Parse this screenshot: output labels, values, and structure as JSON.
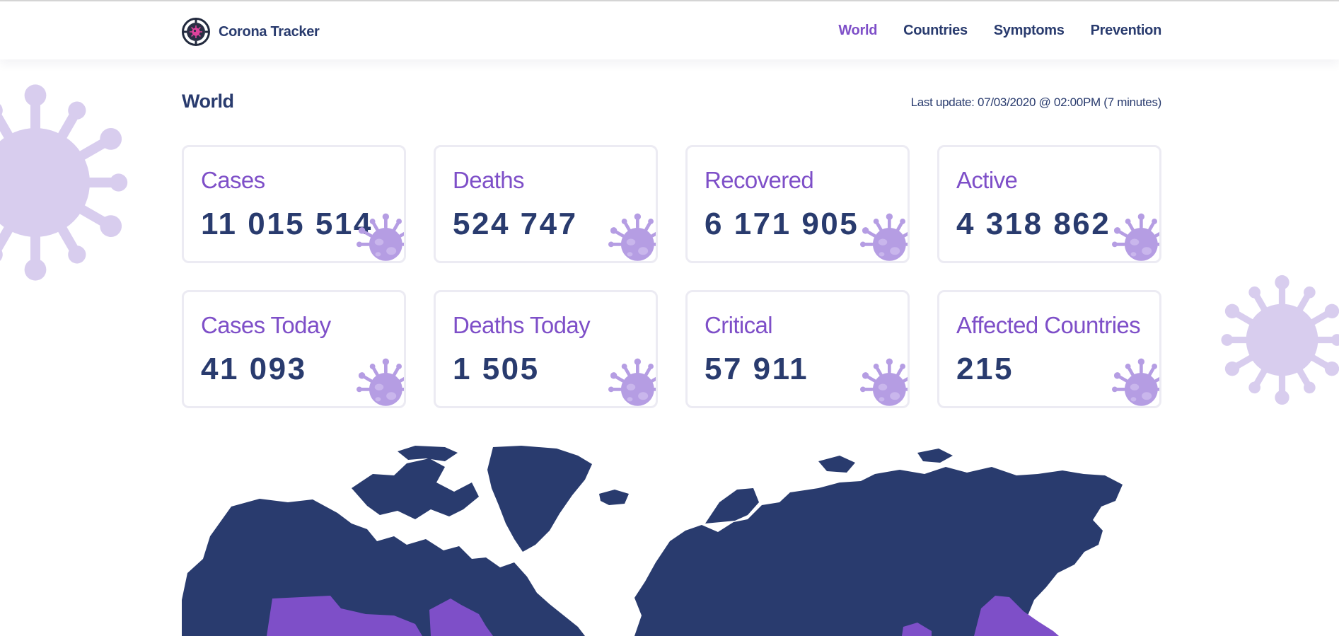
{
  "app": {
    "name": "Corona Tracker",
    "logo_icon": "virus-target-logo-icon"
  },
  "nav": {
    "items": [
      {
        "label": "World",
        "active": true
      },
      {
        "label": "Countries",
        "active": false
      },
      {
        "label": "Symptoms",
        "active": false
      },
      {
        "label": "Prevention",
        "active": false
      }
    ]
  },
  "section": {
    "title": "World",
    "last_update": "Last update: 07/03/2020 @ 02:00PM (7 minutes)"
  },
  "stats": [
    {
      "label": "Cases",
      "value": "11 015 514"
    },
    {
      "label": "Deaths",
      "value": "524 747"
    },
    {
      "label": "Recovered",
      "value": "6 171 905"
    },
    {
      "label": "Active",
      "value": "4 318 862"
    },
    {
      "label": "Cases Today",
      "value": "41 093"
    },
    {
      "label": "Deaths Today",
      "value": "1 505"
    },
    {
      "label": "Critical",
      "value": "57 911"
    },
    {
      "label": "Affected Countries",
      "value": "215"
    }
  ],
  "theme": {
    "primary": "#293b6e",
    "accent": "#7e4fc8",
    "accent_light": "#d8cdee",
    "map_affected": "#7e4fc8",
    "map_base": "#293b6e"
  },
  "icons": {
    "card_decoration": "virus-icon",
    "background_decoration": "virus-icon"
  }
}
